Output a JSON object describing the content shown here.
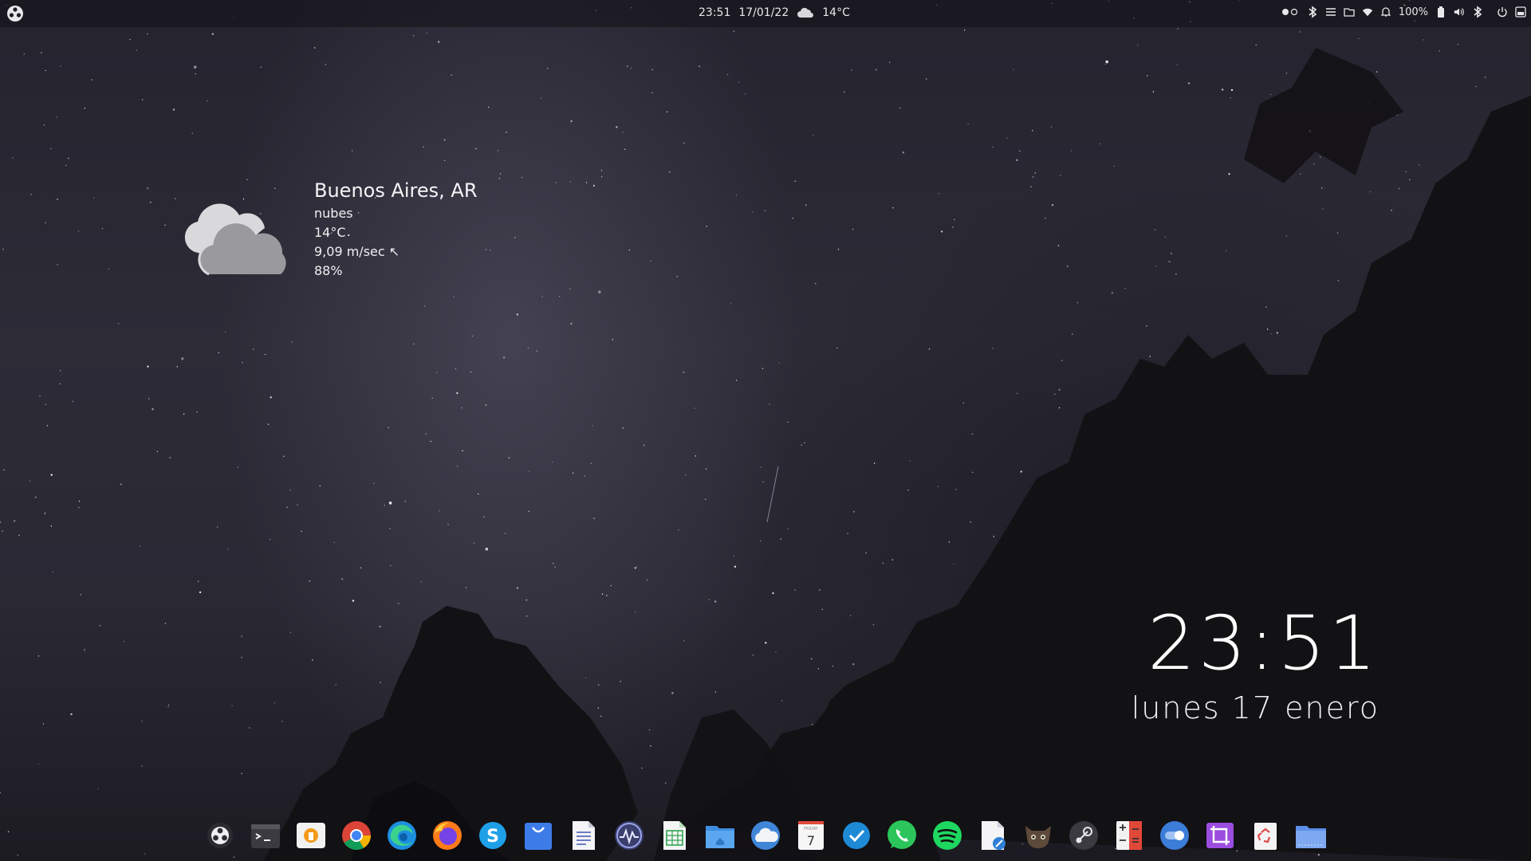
{
  "topbar": {
    "time": "23:51",
    "date": "17/01/22",
    "temp": "14°C",
    "battery": "100%",
    "icons": [
      "activities-icon",
      "workspace-dots-icon",
      "bluetooth-icon",
      "menu-icon",
      "folder-icon",
      "wifi-icon",
      "bell-icon",
      "battery-icon",
      "volume-icon",
      "bluetooth-icon",
      "power-icon",
      "panel-icon"
    ]
  },
  "weather": {
    "city": "Buenos Aires, AR",
    "condition": "nubes",
    "temperature": "14°C",
    "wind": "9,09 m/sec ↖",
    "humidity": "88%"
  },
  "clock": {
    "time": "23:51",
    "date": "lunes 17 enero"
  },
  "dock": {
    "calendar_day": "7",
    "calendar_weekday": "FRIDAY",
    "apps": [
      "activities",
      "terminal",
      "installer",
      "chrome",
      "edge",
      "firefox",
      "skype",
      "store",
      "text-editor",
      "system-monitor",
      "spreadsheet",
      "files",
      "weather",
      "calendar",
      "tasks",
      "whatsapp",
      "spotify",
      "document-editor",
      "gimp",
      "steam",
      "calculator",
      "toggle",
      "screenshot",
      "trash",
      "folder"
    ]
  }
}
